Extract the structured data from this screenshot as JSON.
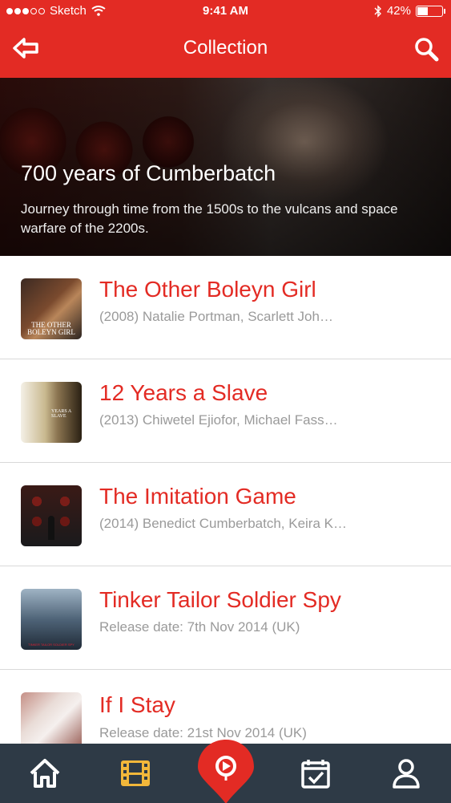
{
  "status_bar": {
    "carrier": "Sketch",
    "time": "9:41 AM",
    "battery": "42%"
  },
  "header": {
    "title": "Collection"
  },
  "hero": {
    "title": "700 years of Cumberbatch",
    "description": "Journey through time from the 1500s to the vulcans and space warfare of the 2200s."
  },
  "movies": [
    {
      "title": "The Other Boleyn Girl",
      "subtitle": "(2008) Natalie Portman, Scarlett Joh…",
      "poster_text": "THE OTHER BOLEYN GIRL"
    },
    {
      "title": "12 Years a Slave",
      "subtitle": "(2013) Chiwetel Ejiofor, Michael Fass…",
      "poster_text": "YEARS A SLAVE"
    },
    {
      "title": "The Imitation Game",
      "subtitle": "(2014) Benedict Cumberbatch, Keira K…"
    },
    {
      "title": "Tinker Tailor Soldier Spy",
      "subtitle": "Release date:  7th Nov 2014 (UK)",
      "poster_text": "TINKER TAILOR SOLDIER SPY"
    },
    {
      "title": "If I Stay",
      "subtitle": "Release date:  21st Nov 2014 (UK)"
    }
  ],
  "tab_bar": {
    "items": [
      "home-icon",
      "film-icon",
      "location-pin-icon",
      "calendar-check-icon",
      "user-icon"
    ],
    "active": "film-icon"
  },
  "colors": {
    "brand_red": "#e32b24",
    "tab_bar_bg": "#2e3a46",
    "active_tab": "#f2b73a",
    "subtitle_gray": "#9a9a9a"
  }
}
